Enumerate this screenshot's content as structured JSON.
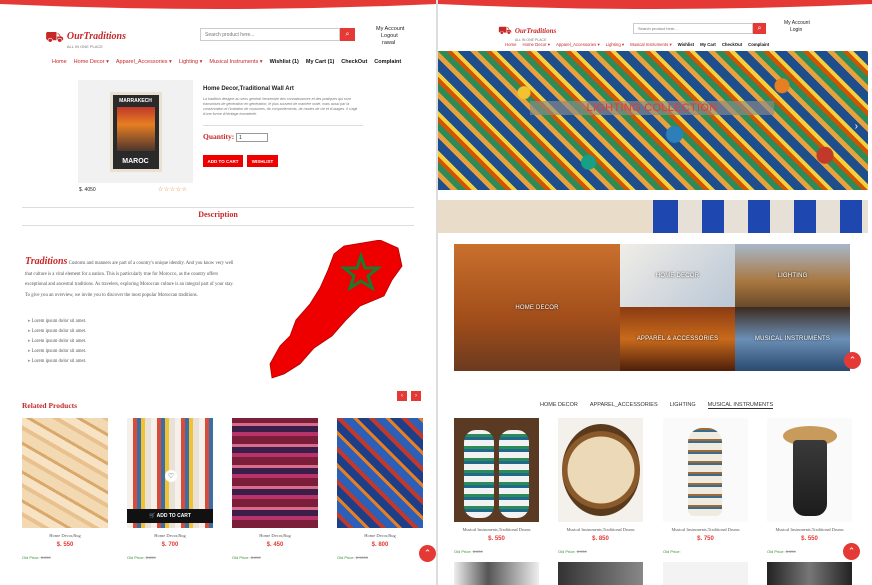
{
  "left": {
    "logo": {
      "name": "OurTraditions",
      "tagline": "ALL IN ONE PLACE"
    },
    "search": {
      "placeholder": "Search product here..."
    },
    "account": [
      "My Account",
      "Logout",
      "rawal"
    ],
    "nav": [
      {
        "label": "Home",
        "bold": false
      },
      {
        "label": "Home Decor ▾",
        "bold": false
      },
      {
        "label": "Apparel_Accessories ▾",
        "bold": false
      },
      {
        "label": "Lighting ▾",
        "bold": false
      },
      {
        "label": "Musical Instruments ▾",
        "bold": false
      },
      {
        "label": "Wishlist (1)",
        "bold": true
      },
      {
        "label": "My Cart (1)",
        "bold": true
      },
      {
        "label": "CheckOut",
        "bold": true
      },
      {
        "label": "Complaint",
        "bold": true
      }
    ],
    "product": {
      "poster_top": "MARRAKECH",
      "poster_bottom": "MAROC",
      "title": "Home Decor,Traditional Wall Art",
      "description": "La tradition désigne au sens général l'ensemble des connaissances et des pratiques qui sont transmises de génération en génération, le plus souvent de manière orale, mais aussi par la conservation et l'imitation de coutumes, de comportements, de modes de vie et d'usages. Il s'agit d'une forme d'héritage immatériel.",
      "quantity_label": "Quantity:",
      "quantity_value": "1",
      "add_to_cart": "ADD TO CART",
      "wishlist": "WISHLIST",
      "price": "$. 4050",
      "rating": "☆☆☆☆☆"
    },
    "description_heading": "Description",
    "traditions": {
      "heading": "Traditions",
      "text": "Customs and manners are part of a country's unique identity. And you know very well that culture is a vital element for a nation. This is particularly true for Morocco, as the country offers exceptional and ancestral traditions. As travelers, exploring Moroccan culture is an integral part of your stay. To give you an overview, we invite you to discover the most popular Moroccan traditions.",
      "bullets": [
        "Lorem ipsum dolor sit amet.",
        "Lorem ipsum dolor sit amet.",
        "Lorem ipsum dolor sit amet.",
        "Lorem ipsum dolor sit amet.",
        "Lorem ipsum dolor sit amet."
      ]
    },
    "related": {
      "heading": "Related Products",
      "prev": "‹",
      "next": "›",
      "items": [
        {
          "name": "Home Decor,Rug",
          "price": "$. 550",
          "old_label": "Old Price:",
          "old_price": "$.650"
        },
        {
          "name": "Home Decor,Rug",
          "price": "$. 700",
          "old_label": "Old Price:",
          "old_price": "$.850",
          "add_to_cart": "ADD TO CART",
          "wish": "♡"
        },
        {
          "name": "Home Decor,Rug",
          "price": "$. 450",
          "old_label": "Old Price:",
          "old_price": "$.650"
        },
        {
          "name": "Home Decor,Rug",
          "price": "$. 800",
          "old_label": "Old Price:",
          "old_price": "$.1000"
        }
      ]
    },
    "scroll_top": "⌃"
  },
  "right": {
    "logo": {
      "name": "OurTraditions",
      "tagline": "ALL IN ONE PLACE"
    },
    "search": {
      "placeholder": "Search product here..."
    },
    "account": [
      "My Account",
      "Login"
    ],
    "nav": [
      {
        "label": "Home",
        "bold": false
      },
      {
        "label": "Home Decor ▾",
        "bold": false
      },
      {
        "label": "Apparel_Accessories ▾",
        "bold": false
      },
      {
        "label": "Lighting ▾",
        "bold": false
      },
      {
        "label": "Musical Instruments ▾",
        "bold": false
      },
      {
        "label": "Wishlist",
        "bold": true
      },
      {
        "label": "My Cart",
        "bold": true
      },
      {
        "label": "CheckOut",
        "bold": true
      },
      {
        "label": "Complaint",
        "bold": true
      }
    ],
    "hero": {
      "label": "LIGHTING COLLECTION",
      "next": "›"
    },
    "categories": [
      "HOME DECOR",
      "HOME DECOR",
      "LIGHTING",
      "APPAREL & ACCESSORIES",
      "MUSICAL INSTRUMENTS"
    ],
    "tabs": [
      "HOME DECOR",
      "APPAREL_ACCESSORIES",
      "LIGHTING",
      "MUSICAL INSTRUMENTS"
    ],
    "products": [
      {
        "name": "Musical Instruments,Traditional Drums",
        "price": "$. 550",
        "old_label": "Old Price:",
        "old_price": "$.650"
      },
      {
        "name": "Musical Instruments,Traditional Drums",
        "price": "$. 850",
        "old_label": "Old Price:",
        "old_price": "$.950"
      },
      {
        "name": "Musical Instruments,Traditional Drums",
        "price": "$. 750",
        "old_label": "Old Price:",
        "old_price": ""
      },
      {
        "name": "Musical Instruments,Traditional Drums",
        "price": "$. 550",
        "old_label": "Old Price:",
        "old_price": "$.650"
      }
    ],
    "scroll_top": "⌃"
  },
  "colors": {
    "brand_red": "#e53935",
    "dark_red": "#c62828",
    "old_price_green": "#3a8f3a"
  },
  "icons": {
    "search": "search-icon",
    "cart_logo": "cart-logo-icon",
    "scroll_up": "chevron-up-icon"
  }
}
